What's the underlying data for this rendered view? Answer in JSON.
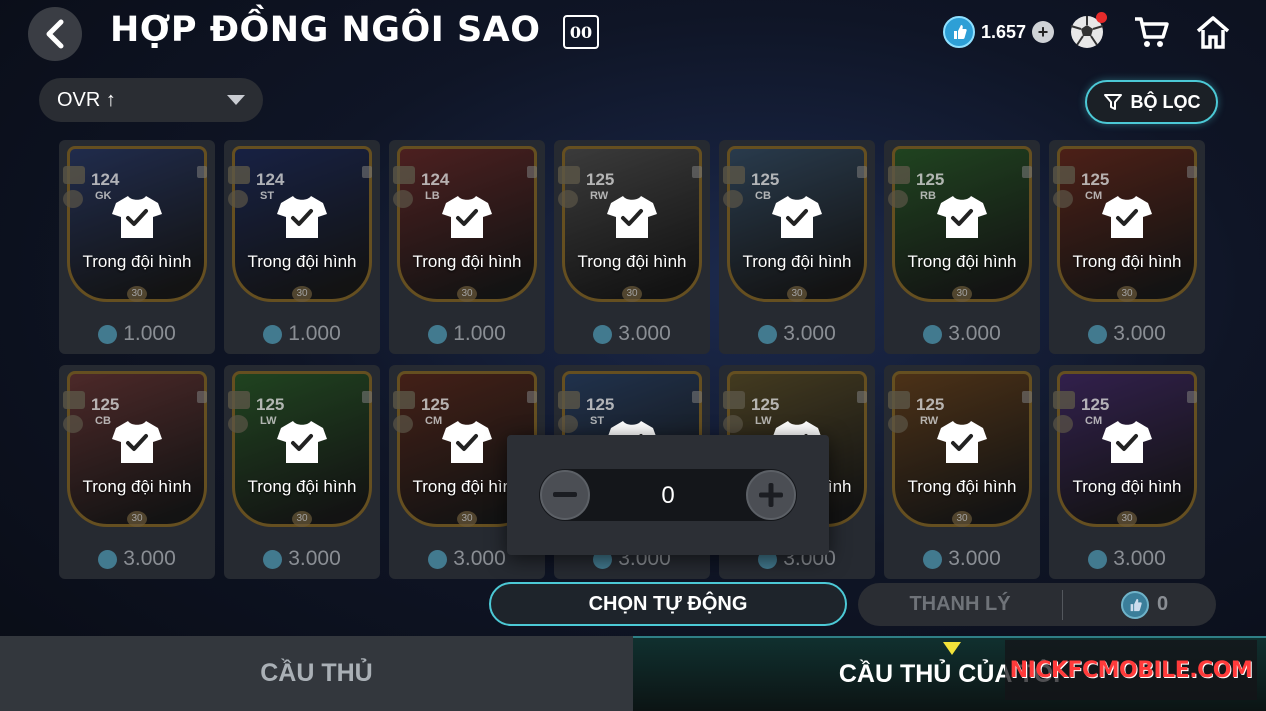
{
  "header": {
    "title": "HỢP ĐỒNG NGÔI SAO",
    "badge": "00",
    "currency_value": "1.657"
  },
  "sort": {
    "label": "OVR ↑"
  },
  "filter": {
    "label": "BỘ LỌC"
  },
  "cards": [
    {
      "ovr": "124",
      "pos": "GK",
      "status": "Trong đội hình",
      "level": "30",
      "price": "1.000",
      "art": "#3a4f8a"
    },
    {
      "ovr": "124",
      "pos": "ST",
      "status": "Trong đội hình",
      "level": "30",
      "price": "1.000",
      "art": "#2a3c7a"
    },
    {
      "ovr": "124",
      "pos": "LB",
      "status": "Trong đội hình",
      "level": "30",
      "price": "1.000",
      "art": "#8a3a3a"
    },
    {
      "ovr": "125",
      "pos": "RW",
      "status": "Trong đội hình",
      "level": "30",
      "price": "3.000",
      "art": "#6a6a6a"
    },
    {
      "ovr": "125",
      "pos": "CB",
      "status": "Trong đội hình",
      "level": "30",
      "price": "3.000",
      "art": "#4a6a8a"
    },
    {
      "ovr": "125",
      "pos": "RB",
      "status": "Trong đội hình",
      "level": "30",
      "price": "3.000",
      "art": "#3a7a3a"
    },
    {
      "ovr": "125",
      "pos": "CM",
      "status": "Trong đội hình",
      "level": "30",
      "price": "3.000",
      "art": "#8a3a2a"
    },
    {
      "ovr": "125",
      "pos": "CB",
      "status": "Trong đội hình",
      "level": "30",
      "price": "3.000",
      "art": "#8a4a4a"
    },
    {
      "ovr": "125",
      "pos": "LW",
      "status": "Trong đội hình",
      "level": "30",
      "price": "3.000",
      "art": "#3a7a3a"
    },
    {
      "ovr": "125",
      "pos": "CM",
      "status": "Trong đội hình",
      "level": "30",
      "price": "3.000",
      "art": "#7a3a2a"
    },
    {
      "ovr": "125",
      "pos": "ST",
      "status": "Trong đội hình",
      "level": "30",
      "price": "3.000",
      "art": "#3a5a8a"
    },
    {
      "ovr": "125",
      "pos": "LW",
      "status": "Trong đội hình",
      "level": "30",
      "price": "3.000",
      "art": "#7a6a3a"
    },
    {
      "ovr": "125",
      "pos": "RW",
      "status": "Trong đội hình",
      "level": "30",
      "price": "3.000",
      "art": "#8a5a2a"
    },
    {
      "ovr": "125",
      "pos": "CM",
      "status": "Trong đội hình",
      "level": "30",
      "price": "3.000",
      "art": "#5a3a8a"
    }
  ],
  "quantity": {
    "value": "0",
    "minus": "−",
    "plus": "+"
  },
  "actions": {
    "auto_select": "CHỌN TỰ ĐỘNG",
    "sell": "THANH LÝ",
    "sell_count": "0"
  },
  "tabs": {
    "players": "CẦU THỦ",
    "my_players": "CẦU THỦ CỦA TÔI"
  },
  "watermark": "NICKFCMOBILE.COM"
}
